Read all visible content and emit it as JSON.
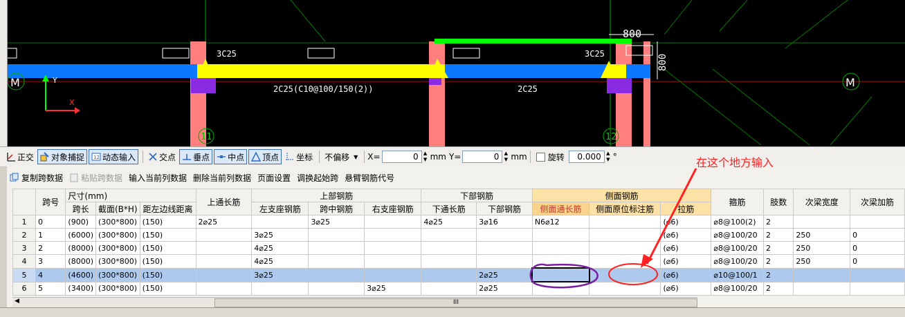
{
  "cad": {
    "dim_800_h": "800",
    "dim_800_v": "800",
    "top_rebar_left": "3C25",
    "top_rebar_right": "3C25",
    "bottom_rebar_left": "2C25(C10@100/150(2))",
    "bottom_rebar_right": "2C25",
    "axis_label_left": "M",
    "axis_label_right": "M",
    "axis_y": "Y",
    "axis_x": "X",
    "grid_11": "11",
    "grid_12": "12"
  },
  "snapbar": {
    "ortho": "正交",
    "object_snap": "对象捕捉",
    "dynamic_input": "动态输入",
    "intersection": "交点",
    "perpendicular": "垂点",
    "midpoint": "中点",
    "vertex": "顶点",
    "coordinate": "坐标",
    "no_offset": "不偏移",
    "x_label": "X=",
    "x_value": "0",
    "mm1": "mm",
    "y_label": "Y=",
    "y_value": "0",
    "mm2": "mm",
    "rotate": "旋转",
    "rotate_value": "0.000",
    "degree": "°"
  },
  "panel_toolbar": {
    "copy": "复制跨数据",
    "paste": "粘贴跨数据",
    "input_col": "输入当前列数据",
    "delete_col": "删除当前列数据",
    "page_setup": "页面设置",
    "swap_start": "调换起始跨",
    "cantilever_code": "悬臂钢筋代号"
  },
  "annotation": "在这个地方输入",
  "table": {
    "h_span_no": "跨号",
    "h_size": "尺寸(mm)",
    "h_span_len": "跨长",
    "h_section": "截面(B*H)",
    "h_side_dist": "距左边线距离",
    "h_top_through": "上通长筋",
    "h_top_group": "上部钢筋",
    "h_left_support": "左支座钢筋",
    "h_mid_span": "跨中钢筋",
    "h_right_support": "右支座钢筋",
    "h_bottom_group": "下部钢筋",
    "h_bottom_through": "下通长筋",
    "h_bottom_rebar": "下部钢筋",
    "h_side_group": "侧面钢筋",
    "h_side_through": "侧面通长筋",
    "h_side_orig": "侧面原位标注筋",
    "h_tie": "拉筋",
    "h_stirrup": "箍筋",
    "h_legs": "肢数",
    "h_sec_width": "次梁宽度",
    "h_sec_add": "次梁加筋",
    "rows": [
      {
        "n": "1",
        "span": "0",
        "len": "(900)",
        "sec": "(300*800)",
        "dist": "(150)",
        "top": "2⌀25",
        "left": "",
        "mid": "3⌀25",
        "right": "",
        "bthru": "4⌀25",
        "brebar": "3⌀16",
        "sthru": "N6⌀12",
        "sorig": "",
        "tie": "(⌀6)",
        "stir": "⌀8@100(2)",
        "legs": "2",
        "sw": "",
        "sa": ""
      },
      {
        "n": "2",
        "span": "1",
        "len": "(6000)",
        "sec": "(300*800)",
        "dist": "(150)",
        "top": "",
        "left": "3⌀25",
        "mid": "",
        "right": "",
        "bthru": "",
        "brebar": "",
        "sthru": "",
        "sorig": "",
        "tie": "(⌀6)",
        "stir": "⌀8@100/20",
        "legs": "2",
        "sw": "250",
        "sa": "0"
      },
      {
        "n": "3",
        "span": "2",
        "len": "(8000)",
        "sec": "(300*800)",
        "dist": "(150)",
        "top": "",
        "left": "4⌀25",
        "mid": "",
        "right": "",
        "bthru": "",
        "brebar": "",
        "sthru": "",
        "sorig": "",
        "tie": "(⌀6)",
        "stir": "⌀8@100/20",
        "legs": "2",
        "sw": "250",
        "sa": "0"
      },
      {
        "n": "4",
        "span": "3",
        "len": "(8000)",
        "sec": "(300*800)",
        "dist": "(150)",
        "top": "",
        "left": "4⌀25",
        "mid": "",
        "right": "",
        "bthru": "",
        "brebar": "",
        "sthru": "",
        "sorig": "",
        "tie": "(⌀6)",
        "stir": "⌀8@100/20",
        "legs": "2",
        "sw": "250",
        "sa": "0"
      },
      {
        "n": "5",
        "span": "4",
        "len": "(4600)",
        "sec": "(300*800)",
        "dist": "(150)",
        "top": "",
        "left": "3⌀25",
        "mid": "",
        "right": "",
        "bthru": "",
        "brebar": "2⌀25",
        "sthru": "",
        "sorig": "",
        "tie": "(⌀6)",
        "stir": "⌀10@100/1",
        "legs": "2",
        "sw": "",
        "sa": ""
      },
      {
        "n": "6",
        "span": "5",
        "len": "(3400)",
        "sec": "(300*800)",
        "dist": "(150)",
        "top": "",
        "left": "",
        "mid": "",
        "right": "3⌀25",
        "bthru": "",
        "brebar": "2⌀25",
        "sthru": "",
        "sorig": "",
        "tie": "(⌀6)",
        "stir": "⌀8@100/20",
        "legs": "2",
        "sw": "",
        "sa": ""
      }
    ]
  },
  "scroll_grip": "III",
  "colors": {
    "beam_blue": "#0a78ff",
    "rebar_yellow": "#ffff00",
    "column_pink": "#ff7f7f",
    "support_purple": "#8a2be2",
    "green_line": "#00ff00",
    "annotation_red": "#ff2020"
  }
}
